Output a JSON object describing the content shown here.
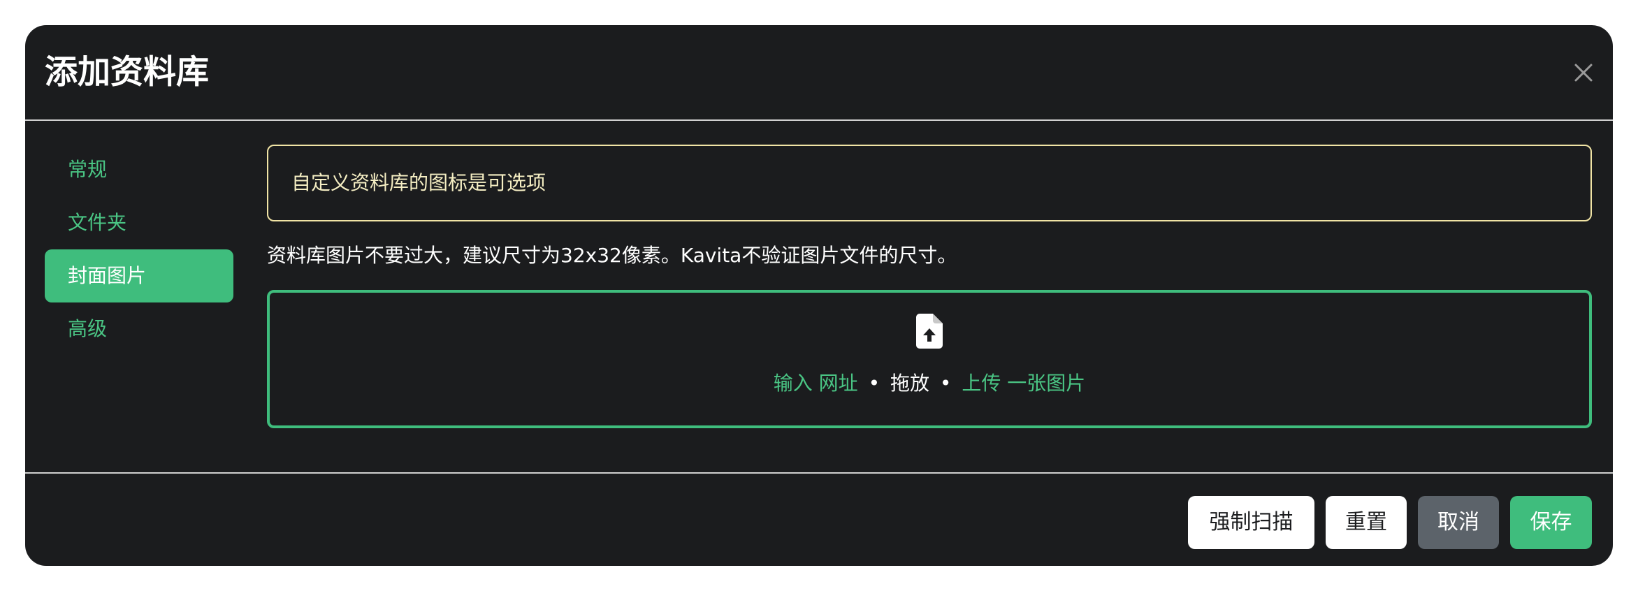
{
  "modal": {
    "title": "添加资料库",
    "close_icon": "close-icon"
  },
  "sidebar": {
    "items": [
      {
        "label": "常规",
        "active": false
      },
      {
        "label": "文件夹",
        "active": false
      },
      {
        "label": "封面图片",
        "active": true
      },
      {
        "label": "高级",
        "active": false
      }
    ]
  },
  "cover": {
    "alert_text": "自定义资料库的图标是可选项",
    "help_text": "资料库图片不要过大，建议尺寸为32x32像素。Kavita不验证图片文件的尺寸。",
    "dropzone": {
      "icon": "file-upload-icon",
      "enter_url_label": "输入 网址",
      "separator": "•",
      "drag_drop_label": "拖放",
      "upload_label": "上传 一张图片"
    }
  },
  "footer": {
    "force_scan_label": "强制扫描",
    "reset_label": "重置",
    "cancel_label": "取消",
    "save_label": "保存"
  },
  "colors": {
    "background": "#1b1c1e",
    "accent": "#3fbd7d",
    "link": "#4ac584",
    "alert_border": "#f1e4a5",
    "secondary_button": "#5c636a"
  }
}
